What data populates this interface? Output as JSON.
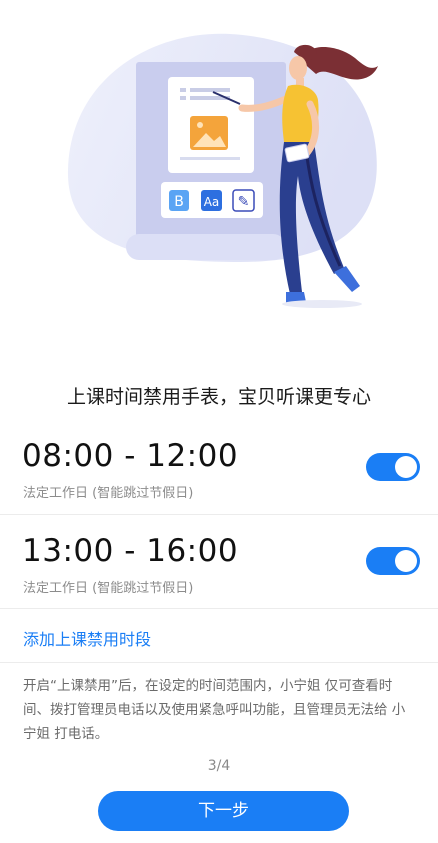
{
  "headline": "上课时间禁用手表，宝贝听课更专心",
  "slots": [
    {
      "time": "08:00 - 12:00",
      "subtitle": "法定工作日 (智能跳过节假日)",
      "enabled": true
    },
    {
      "time": "13:00 - 16:00",
      "subtitle": "法定工作日 (智能跳过节假日)",
      "enabled": true
    }
  ],
  "add_link": "添加上课禁用时段",
  "description": "开启“上课禁用”后，在设定的时间范围内，小宁姐 仅可查看时间、拨打管理员电话以及使用紧急呼叫功能，且管理员无法给 小宁姐 打电话。",
  "pager": "3/4",
  "next_button": "下一步",
  "illustration": {
    "icons": [
      {
        "name": "bold-icon",
        "glyph": "B"
      },
      {
        "name": "font-icon",
        "glyph": "Aa"
      },
      {
        "name": "pen-icon",
        "glyph": "✎"
      }
    ]
  },
  "colors": {
    "accent": "#1a7ef5"
  }
}
